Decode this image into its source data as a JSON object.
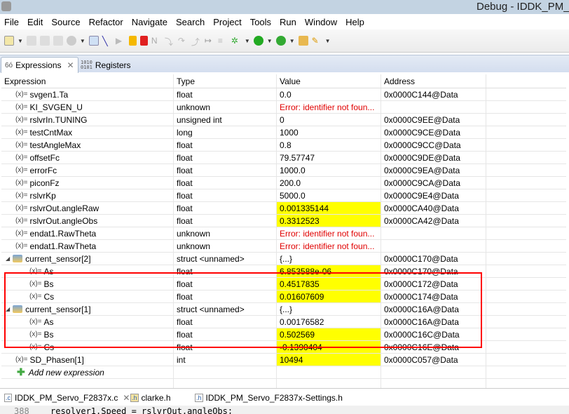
{
  "window": {
    "title": "Debug - IDDK_PM_S"
  },
  "menu": [
    "File",
    "Edit",
    "Source",
    "Refactor",
    "Navigate",
    "Search",
    "Project",
    "Tools",
    "Run",
    "Window",
    "Help"
  ],
  "view_tabs": {
    "expressions": "Expressions",
    "registers": "Registers"
  },
  "columns": [
    "Expression",
    "Type",
    "Value",
    "Address"
  ],
  "rows": [
    {
      "name": "svgen1.Ta",
      "type": "float",
      "value": "0.0",
      "address": "0x0000C144@Data",
      "level": 0
    },
    {
      "name": "KI_SVGEN_U",
      "type": "unknown",
      "value": "Error: identifier not foun...",
      "address": "",
      "error": true,
      "level": 0
    },
    {
      "name": "rslvrIn.TUNING",
      "type": "unsigned int",
      "value": "0",
      "address": "0x0000C9EE@Data",
      "level": 0
    },
    {
      "name": "testCntMax",
      "type": "long",
      "value": "1000",
      "address": "0x0000C9CE@Data",
      "level": 0
    },
    {
      "name": "testAngleMax",
      "type": "float",
      "value": "0.8",
      "address": "0x0000C9CC@Data",
      "level": 0
    },
    {
      "name": "offsetFc",
      "type": "float",
      "value": "79.57747",
      "address": "0x0000C9DE@Data",
      "level": 0
    },
    {
      "name": "errorFc",
      "type": "float",
      "value": "1000.0",
      "address": "0x0000C9EA@Data",
      "level": 0
    },
    {
      "name": "piconFz",
      "type": "float",
      "value": "200.0",
      "address": "0x0000C9CA@Data",
      "level": 0
    },
    {
      "name": "rslvrKp",
      "type": "float",
      "value": "5000.0",
      "address": "0x0000C9E4@Data",
      "level": 0
    },
    {
      "name": "rslvrOut.angleRaw",
      "type": "float",
      "value": "0.001335144",
      "address": "0x0000CA40@Data",
      "highlight": true,
      "level": 0
    },
    {
      "name": "rslvrOut.angleObs",
      "type": "float",
      "value": "0.3312523",
      "address": "0x0000CA42@Data",
      "highlight": true,
      "level": 0
    },
    {
      "name": "endat1.RawTheta",
      "type": "unknown",
      "value": "Error: identifier not foun...",
      "address": "",
      "error": true,
      "level": 0
    },
    {
      "name": "endat1.RawTheta",
      "type": "unknown",
      "value": "Error: identifier not foun...",
      "address": "",
      "error": true,
      "level": 0
    },
    {
      "name": "current_sensor[2]",
      "type": "struct <unnamed>",
      "value": "{...}",
      "address": "0x0000C170@Data",
      "struct": true,
      "level": 0
    },
    {
      "name": "As",
      "type": "float",
      "value": "6.853588e-06",
      "address": "0x0000C170@Data",
      "highlight": true,
      "level": 1
    },
    {
      "name": "Bs",
      "type": "float",
      "value": "0.4517835",
      "address": "0x0000C172@Data",
      "highlight": true,
      "level": 1
    },
    {
      "name": "Cs",
      "type": "float",
      "value": "0.01607609",
      "address": "0x0000C174@Data",
      "highlight": true,
      "level": 1
    },
    {
      "name": "current_sensor[1]",
      "type": "struct <unnamed>",
      "value": "{...}",
      "address": "0x0000C16A@Data",
      "struct": true,
      "level": 0
    },
    {
      "name": "As",
      "type": "float",
      "value": "0.00176582",
      "address": "0x0000C16A@Data",
      "level": 1
    },
    {
      "name": "Bs",
      "type": "float",
      "value": "0.502569",
      "address": "0x0000C16C@Data",
      "highlight": true,
      "level": 1
    },
    {
      "name": "Cs",
      "type": "float",
      "value": "-0.1390404",
      "address": "0x0000C16E@Data",
      "highlight": true,
      "level": 1
    },
    {
      "name": "SD_Phasen[1]",
      "type": "int",
      "value": "10494",
      "address": "0x0000C057@Data",
      "highlight": true,
      "level": 0
    }
  ],
  "add_expression": "Add new expression",
  "var_icon": "(x)=",
  "editor_tabs": [
    "IDDK_PM_Servo_F2837x.c",
    "clarke.h",
    "IDDK_PM_Servo_F2837x-Settings.h"
  ],
  "code": {
    "line": "388",
    "text": "resolver1.Speed    = rslvrOut.angleObs;"
  },
  "colors": {
    "highlight": "#ffff00",
    "error": "#e00000",
    "annotation": "#ff0000"
  }
}
